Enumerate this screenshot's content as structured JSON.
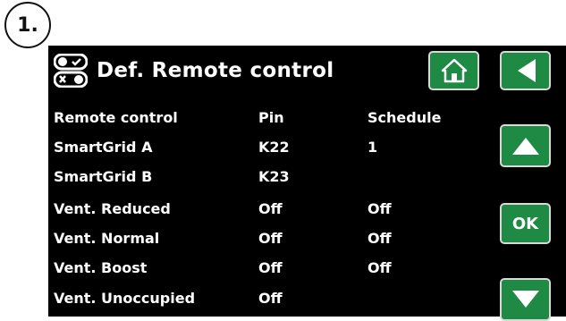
{
  "step_badge": "1.",
  "screen": {
    "title": "Def. Remote control",
    "icons": {
      "remote": "remote-control-icon",
      "home": "home-icon",
      "back": "arrow-left-icon",
      "up": "arrow-up-icon",
      "down": "arrow-down-icon"
    },
    "ok_label": "OK",
    "table": {
      "headers": [
        "Remote control",
        "Pin",
        "Schedule"
      ],
      "rows": [
        {
          "name": "SmartGrid A",
          "pin": "K22",
          "schedule": "1"
        },
        {
          "name": "SmartGrid B",
          "pin": "K23",
          "schedule": ""
        },
        {
          "name": "Vent. Reduced",
          "pin": "Off",
          "schedule": "Off"
        },
        {
          "name": "Vent. Normal",
          "pin": "Off",
          "schedule": "Off"
        },
        {
          "name": "Vent. Boost",
          "pin": "Off",
          "schedule": "Off"
        },
        {
          "name": "Vent. Unoccupied",
          "pin": "Off",
          "schedule": ""
        }
      ]
    }
  },
  "colors": {
    "screen_bg": "#000000",
    "button_green": "#1e8a44",
    "button_border": "#d9d9d9",
    "text": "#ffffff"
  }
}
